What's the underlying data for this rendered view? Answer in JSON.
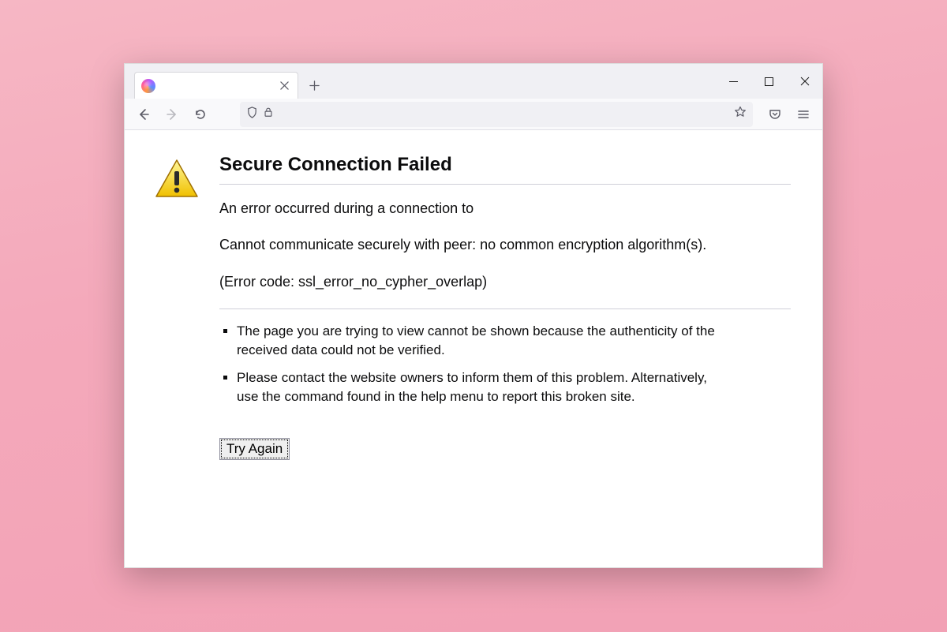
{
  "tab": {
    "title": ""
  },
  "error": {
    "heading": "Secure Connection Failed",
    "line1": "An error occurred during a connection to",
    "line2": "Cannot communicate securely with peer: no common encryption algorithm(s).",
    "code": "(Error code: ssl_error_no_cypher_overlap)",
    "bullets": [
      "The page you are trying to view cannot be shown because the authenticity of the received data could not be verified.",
      "Please contact the website owners to inform them of this problem. Alternatively, use the command found in the help menu to report this broken site."
    ],
    "try_again": "Try Again"
  }
}
